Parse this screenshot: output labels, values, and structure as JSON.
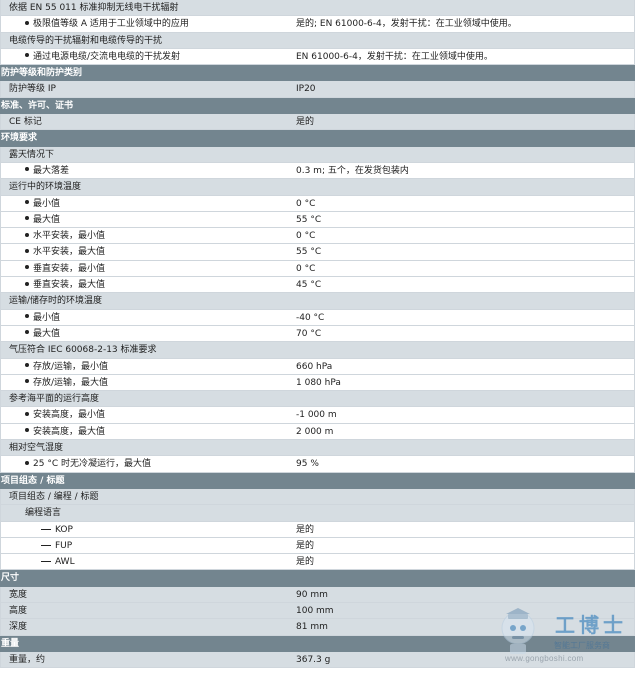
{
  "rows": [
    {
      "kind": "sub",
      "label": "依据 EN 55 011 标准抑制无线电干扰辐射",
      "value": ""
    },
    {
      "kind": "item",
      "label": "极限值等级 A 适用于工业领域中的应用",
      "value": "是的; EN 61000-6-4，发射干扰：在工业领域中使用。"
    },
    {
      "kind": "sub",
      "label": "电缆传导的干扰辐射和电缆传导的干扰",
      "value": ""
    },
    {
      "kind": "item",
      "label": "通过电源电缆/交流电电缆的干扰发射",
      "value": "EN 61000-6-4，发射干扰：在工业领域中使用。"
    },
    {
      "kind": "cat",
      "label": "防护等级和防护类别",
      "value": ""
    },
    {
      "kind": "sub",
      "label": "防护等级 IP",
      "value": "IP20"
    },
    {
      "kind": "cat",
      "label": "标准、许可、证书",
      "value": ""
    },
    {
      "kind": "sub",
      "label": "CE 标记",
      "value": "是的"
    },
    {
      "kind": "cat",
      "label": "环境要求",
      "value": ""
    },
    {
      "kind": "sub",
      "label": "露天情况下",
      "value": ""
    },
    {
      "kind": "item",
      "label": "最大落差",
      "value": "0.3 m; 五个，在发货包装内"
    },
    {
      "kind": "sub",
      "label": "运行中的环境温度",
      "value": ""
    },
    {
      "kind": "item",
      "label": "最小值",
      "value": "0 °C"
    },
    {
      "kind": "item",
      "label": "最大值",
      "value": "55 °C"
    },
    {
      "kind": "item",
      "label": "水平安装，最小值",
      "value": "0 °C"
    },
    {
      "kind": "item",
      "label": "水平安装，最大值",
      "value": "55 °C"
    },
    {
      "kind": "item",
      "label": "垂直安装，最小值",
      "value": "0 °C"
    },
    {
      "kind": "item",
      "label": "垂直安装，最大值",
      "value": "45 °C"
    },
    {
      "kind": "sub",
      "label": "运输/储存时的环境温度",
      "value": ""
    },
    {
      "kind": "item",
      "label": "最小值",
      "value": "-40 °C"
    },
    {
      "kind": "item",
      "label": "最大值",
      "value": "70 °C"
    },
    {
      "kind": "sub",
      "label": "气压符合 IEC 60068-2-13 标准要求",
      "value": ""
    },
    {
      "kind": "item",
      "label": "存放/运输，最小值",
      "value": "660 hPa"
    },
    {
      "kind": "item",
      "label": "存放/运输，最大值",
      "value": "1 080 hPa"
    },
    {
      "kind": "sub",
      "label": "参考海平面的运行高度",
      "value": ""
    },
    {
      "kind": "item",
      "label": "安装高度，最小值",
      "value": "-1 000 m"
    },
    {
      "kind": "item",
      "label": "安装高度，最大值",
      "value": "2 000 m"
    },
    {
      "kind": "sub",
      "label": "相对空气湿度",
      "value": ""
    },
    {
      "kind": "item",
      "label": "25 °C 时无冷凝运行，最大值",
      "value": "95 %"
    },
    {
      "kind": "cat",
      "label": "项目组态 / 标题",
      "value": ""
    },
    {
      "kind": "sub",
      "label": "项目组态 / 编程 / 标题",
      "value": ""
    },
    {
      "kind": "sub2",
      "label": "编程语言",
      "value": ""
    },
    {
      "kind": "dash",
      "label": "KOP",
      "value": "是的"
    },
    {
      "kind": "dash",
      "label": "FUP",
      "value": "是的"
    },
    {
      "kind": "dash",
      "label": "AWL",
      "value": "是的"
    },
    {
      "kind": "cat",
      "label": "尺寸",
      "value": ""
    },
    {
      "kind": "sub",
      "label": "宽度",
      "value": "90 mm"
    },
    {
      "kind": "sub",
      "label": "高度",
      "value": "100 mm"
    },
    {
      "kind": "sub",
      "label": "深度",
      "value": "81 mm"
    },
    {
      "kind": "cat",
      "label": "重量",
      "value": ""
    },
    {
      "kind": "sub",
      "label": "重量，约",
      "value": "367.3 g"
    }
  ],
  "watermark": {
    "name": "工博士",
    "tagline": "智能工厂服务商",
    "url": "www.gongboshi.com",
    "icon": "robot-mascot-icon",
    "color": "#2a78b8"
  },
  "colors": {
    "category_bg": "#73858f",
    "subheader_bg": "#d6dde2",
    "grid_line": "#cfd6dc"
  }
}
